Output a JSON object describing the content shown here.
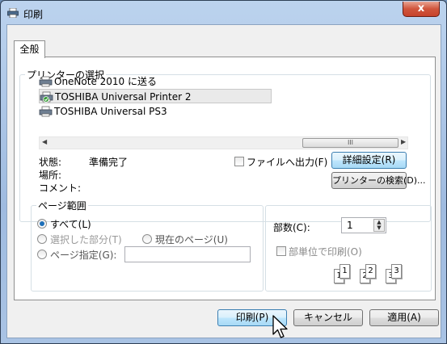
{
  "window": {
    "title": "印刷",
    "close_label": "x"
  },
  "tabs": [
    {
      "label": "全般"
    }
  ],
  "printer_group": {
    "label": "プリンターの選択",
    "printers": [
      {
        "name": "OneNote 2010 に送る",
        "selected": false
      },
      {
        "name": "TOSHIBA Universal Printer 2",
        "selected": true
      },
      {
        "name": "TOSHIBA Universal PS3",
        "selected": false
      }
    ],
    "scroll_thumb_glyph": "III"
  },
  "status": {
    "state_label": "状態:",
    "state_value": "準備完了",
    "location_label": "場所:",
    "comment_label": "コメント:"
  },
  "print_to_file_label": "ファイルへ出力(F)",
  "details_button": "詳細設定(R)",
  "find_printer_button": "プリンターの検索(D)...",
  "page_range": {
    "label": "ページ範囲",
    "all": "すべて(L)",
    "selection": "選択した部分(T)",
    "current_page": "現在のページ(U)",
    "pages": "ページ指定(G):",
    "selected_option": "all",
    "pages_value": ""
  },
  "copies": {
    "label": "部数(C):",
    "value": "1",
    "collate_label": "部単位で印刷(O)",
    "collate_pages": [
      "1",
      "1",
      "2",
      "2",
      "3",
      "3"
    ]
  },
  "footer": {
    "print_button": "印刷(P)",
    "cancel_button": "キャンセル",
    "apply_button": "適用(A)"
  }
}
